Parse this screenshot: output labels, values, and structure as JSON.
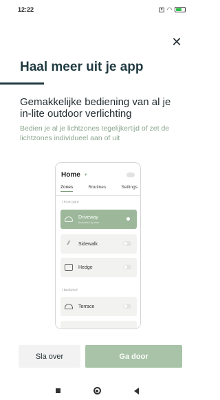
{
  "status_bar": {
    "time": "12:22",
    "battery_level_percent": 70
  },
  "dialog": {
    "close_label": "✕",
    "title": "Haal meer uit je app",
    "subtitle": "Gemakkelijke bediening van al je in-lite outdoor verlichting",
    "description": "Bedien je al je lichtzones tegelijkertijd of zet de lichtzones individueel aan of uit"
  },
  "preview": {
    "home_label": "Home",
    "dropdown_icon": "chevron-down-icon",
    "tabs": [
      "Zones",
      "Routines",
      "Settings"
    ],
    "active_tab": "Zones",
    "sections": {
      "front_yard": "Front yard",
      "backyard": "Backyard"
    },
    "zones": [
      {
        "name": "Driveway",
        "sub": "Activated by user",
        "on": true,
        "icon": "car-icon"
      },
      {
        "name": "Sidewalk",
        "sub": "",
        "on": false,
        "icon": "path-icon"
      },
      {
        "name": "Hedge",
        "sub": "",
        "on": false,
        "icon": "hedge-icon"
      },
      {
        "name": "Terrace",
        "sub": "",
        "on": false,
        "icon": "terrace-icon"
      }
    ]
  },
  "actions": {
    "skip_label": "Sla over",
    "continue_label": "Ga door"
  },
  "colors": {
    "accent": "#a8c3a7",
    "title": "#1f3a40",
    "description": "#8aa58e"
  }
}
